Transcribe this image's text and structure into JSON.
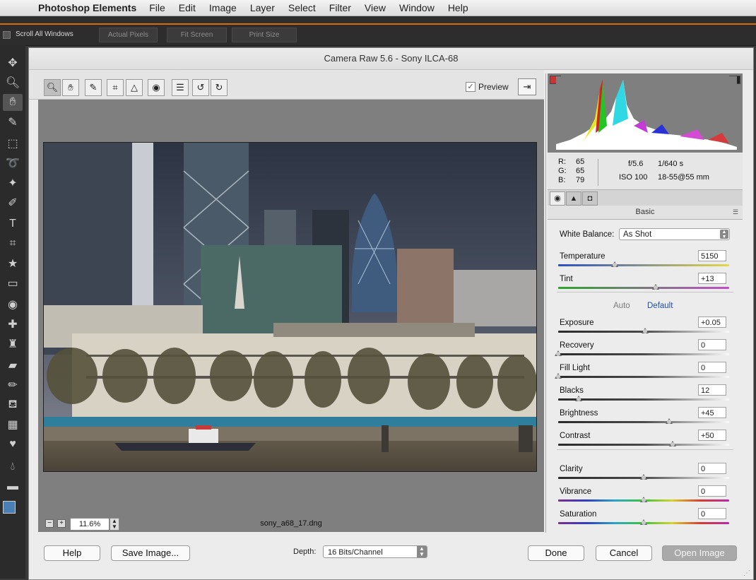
{
  "menubar": {
    "app_name": "Photoshop Elements",
    "items": [
      "File",
      "Edit",
      "Image",
      "Layer",
      "Select",
      "Filter",
      "View",
      "Window",
      "Help"
    ]
  },
  "options_bar": {
    "scroll_all_windows": "Scroll All Windows",
    "actual_pixels": "Actual Pixels",
    "fit_screen": "Fit Screen",
    "print_size": "Print Size"
  },
  "dialog": {
    "title": "Camera Raw 5.6  -  Sony ILCA-68",
    "preview_label": "Preview",
    "preview_checked": true,
    "zoom": "11.6%",
    "filename": "sony_a68_17.dng"
  },
  "readout": {
    "r_label": "R:",
    "g_label": "G:",
    "b_label": "B:",
    "r": "65",
    "g": "65",
    "b": "79",
    "aperture": "f/5.6",
    "shutter": "1/640 s",
    "iso": "ISO 100",
    "lens": "18-55@55 mm"
  },
  "panel": {
    "section": "Basic",
    "white_balance_label": "White Balance:",
    "white_balance_value": "As Shot",
    "auto": "Auto",
    "default": "Default",
    "sliders": [
      {
        "label": "Temperature",
        "value": "5150",
        "pos": 0.33,
        "track": "temp"
      },
      {
        "label": "Tint",
        "value": "+13",
        "pos": 0.57,
        "track": "tint"
      },
      {
        "label": "Exposure",
        "value": "+0.05",
        "pos": 0.51,
        "track": "gray"
      },
      {
        "label": "Recovery",
        "value": "0",
        "pos": 0.0,
        "track": "gray"
      },
      {
        "label": "Fill Light",
        "value": "0",
        "pos": 0.0,
        "track": "gray"
      },
      {
        "label": "Blacks",
        "value": "12",
        "pos": 0.12,
        "track": "gray"
      },
      {
        "label": "Brightness",
        "value": "+45",
        "pos": 0.65,
        "track": "gray"
      },
      {
        "label": "Contrast",
        "value": "+50",
        "pos": 0.67,
        "track": "gray"
      },
      {
        "label": "Clarity",
        "value": "0",
        "pos": 0.5,
        "track": "gray"
      },
      {
        "label": "Vibrance",
        "value": "0",
        "pos": 0.5,
        "track": "color"
      },
      {
        "label": "Saturation",
        "value": "0",
        "pos": 0.5,
        "track": "color"
      }
    ]
  },
  "bottom": {
    "help": "Help",
    "save_image": "Save Image...",
    "depth_label": "Depth:",
    "depth_value": "16 Bits/Channel",
    "done": "Done",
    "cancel": "Cancel",
    "open_image": "Open Image"
  },
  "colors": {
    "accent": "#d86a12",
    "tint_track": "linear-gradient(to right,#2fa52f,#c04fc6)",
    "temp_track": "linear-gradient(to right,#2b4fc9,#e4d84a)"
  }
}
